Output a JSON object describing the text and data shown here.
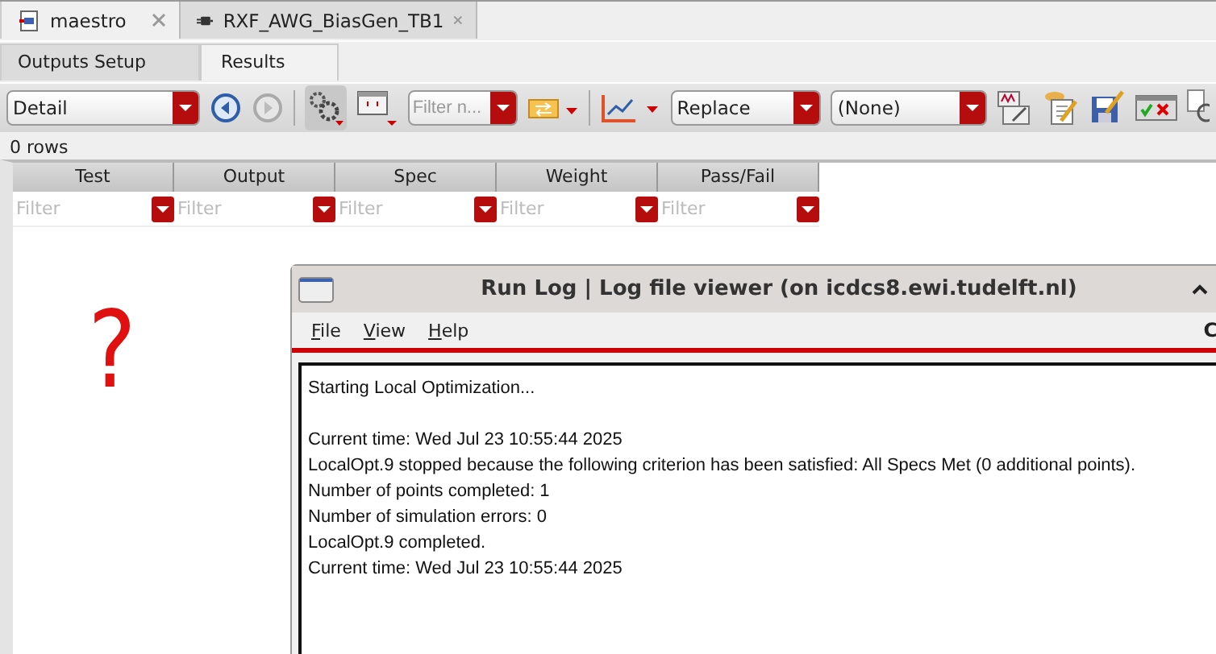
{
  "tabs": [
    {
      "label": "maestro",
      "selected": true
    },
    {
      "label": "RXF_AWG_BiasGen_TB1",
      "selected": false
    }
  ],
  "subtabs": [
    {
      "label": "Outputs Setup",
      "selected": false
    },
    {
      "label": "Results",
      "selected": true
    }
  ],
  "toolbar": {
    "view_select": "Detail",
    "filter_field": {
      "placeholder": "Filter n..."
    },
    "plot_mode": "Replace",
    "plot_select": "(None)"
  },
  "row_count": "0 rows",
  "table": {
    "columns": [
      {
        "label": "Test",
        "filter_placeholder": "Filter"
      },
      {
        "label": "Output",
        "filter_placeholder": "Filter"
      },
      {
        "label": "Spec",
        "filter_placeholder": "Filter"
      },
      {
        "label": "Weight",
        "filter_placeholder": "Filter"
      },
      {
        "label": "Pass/Fail",
        "filter_placeholder": "Filter"
      }
    ]
  },
  "annotation": "?",
  "log_window": {
    "title": "Run Log | Log file viewer (on icdcs8.ewi.tudelft.nl)",
    "menu": [
      "File",
      "View",
      "Help"
    ],
    "menu_right": "C",
    "paragraphs": [
      [
        "Starting Local Optimization..."
      ],
      [
        "Current time: Wed Jul 23 10:55:44 2025",
        "LocalOpt.9 stopped because the following criterion has been satisfied:  All Specs Met (0 additional points).",
        "Number of points completed: 1",
        "Number of simulation errors: 0",
        "LocalOpt.9 completed.",
        "Current time: Wed Jul 23 10:55:44 2025"
      ]
    ]
  }
}
